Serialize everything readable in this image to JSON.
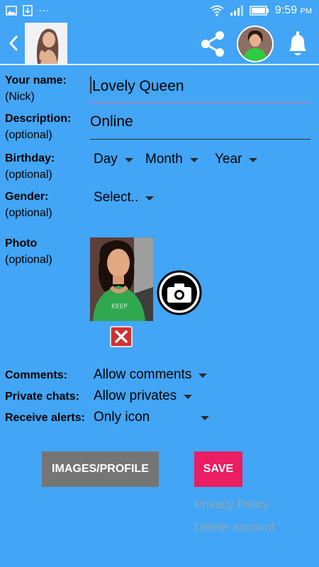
{
  "status": {
    "time": "9:59",
    "ampm": "PM",
    "dots": "···"
  },
  "form": {
    "name_label": "Your name:",
    "name_hint": "(Nick)",
    "name_value": "Lovely Queen",
    "description_label": "Description:",
    "description_hint": "(optional)",
    "description_value": "Online",
    "birthday_label": "Birthday:",
    "birthday_hint": "(optional)",
    "day": "Day",
    "month": "Month",
    "year": "Year",
    "gender_label": "Gender:",
    "gender_hint": "(optional)",
    "gender_value": "Select..",
    "photo_label": "Photo",
    "photo_hint": "(optional)",
    "comments_label": "Comments:",
    "comments_value": "Allow comments",
    "private_label": "Private chats:",
    "private_value": "Allow privates",
    "alerts_label": "Receive alerts:",
    "alerts_value": "Only icon"
  },
  "buttons": {
    "images_profile": "IMAGES/PROFILE",
    "save": "SAVE",
    "privacy": "Privacy Policy",
    "delete": "Delete account"
  },
  "colors": {
    "background": "#42A5F5",
    "save": "#E91E63",
    "images": "#757575",
    "link": "#8FA6B3",
    "field_active_underline": "#E57373"
  }
}
